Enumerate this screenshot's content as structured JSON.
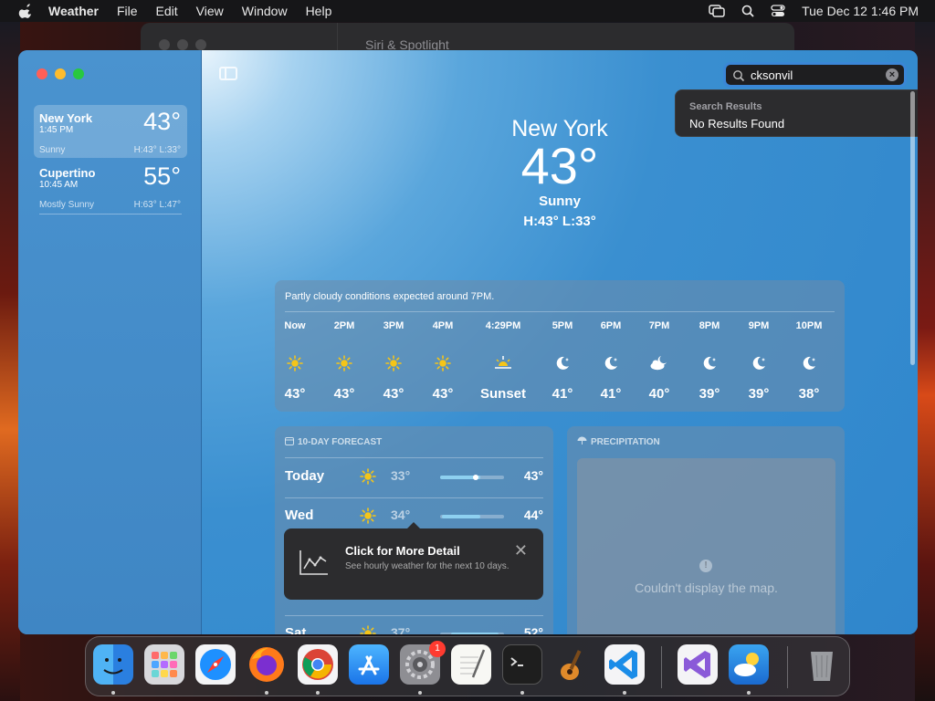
{
  "menubar": {
    "app_name": "Weather",
    "menus": [
      "File",
      "Edit",
      "View",
      "Window",
      "Help"
    ],
    "clock": "Tue Dec 12  1:46 PM"
  },
  "background_window": {
    "title": "Siri & Spotlight"
  },
  "sidebar": {
    "locations": [
      {
        "city": "New York",
        "time": "1:45 PM",
        "temp": "43°",
        "condition": "Sunny",
        "hilo": "H:43°  L:33°"
      },
      {
        "city": "Cupertino",
        "time": "10:45 AM",
        "temp": "55°",
        "condition": "Mostly Sunny",
        "hilo": "H:63°  L:47°"
      }
    ]
  },
  "search": {
    "value": "cksonvil",
    "results_heading": "Search Results",
    "results_message": "No Results Found"
  },
  "current": {
    "city": "New York",
    "temp": "43°",
    "condition": "Sunny",
    "hilo": "H:43°  L:33°"
  },
  "hourly": {
    "summary": "Partly cloudy conditions expected around 7PM.",
    "hours": [
      {
        "label": "Now",
        "icon": "sun-icon",
        "value": "43°"
      },
      {
        "label": "2PM",
        "icon": "sun-icon",
        "value": "43°"
      },
      {
        "label": "3PM",
        "icon": "sun-icon",
        "value": "43°"
      },
      {
        "label": "4PM",
        "icon": "sun-icon",
        "value": "43°"
      },
      {
        "label": "4:29PM",
        "icon": "sunset-icon",
        "value": "Sunset"
      },
      {
        "label": "5PM",
        "icon": "moon-icon",
        "value": "41°"
      },
      {
        "label": "6PM",
        "icon": "moon-icon",
        "value": "41°"
      },
      {
        "label": "7PM",
        "icon": "cloud-moon-icon",
        "value": "40°"
      },
      {
        "label": "8PM",
        "icon": "moon-icon",
        "value": "39°"
      },
      {
        "label": "9PM",
        "icon": "moon-icon",
        "value": "39°"
      },
      {
        "label": "10PM",
        "icon": "moon-icon",
        "value": "38°"
      }
    ]
  },
  "ten_day": {
    "header": "10-DAY FORECAST",
    "days": [
      {
        "day": "Today",
        "icon": "sun-icon",
        "low": "33°",
        "high": "43°"
      },
      {
        "day": "Wed",
        "icon": "sun-icon",
        "low": "34°",
        "high": "44°"
      },
      {
        "day": "Sat",
        "icon": "sun-icon",
        "low": "37°",
        "high": "52°"
      }
    ]
  },
  "precipitation": {
    "header": "PRECIPITATION",
    "map_message": "Couldn't display the map."
  },
  "tooltip": {
    "title": "Click for More Detail",
    "body": "See hourly weather for the next 10 days."
  },
  "dock": {
    "apps": [
      "Finder",
      "Launchpad",
      "Safari",
      "Firefox",
      "Chrome",
      "App Store",
      "System Settings",
      "TextEdit",
      "Terminal",
      "GarageBand",
      "Visual Studio Code",
      "Visual Studio",
      "Weather",
      "Trash"
    ],
    "settings_badge": "1"
  },
  "colors": {
    "accent": "#3a86d6",
    "sun": "#f5c518",
    "window_blue": "#2f86cc"
  }
}
